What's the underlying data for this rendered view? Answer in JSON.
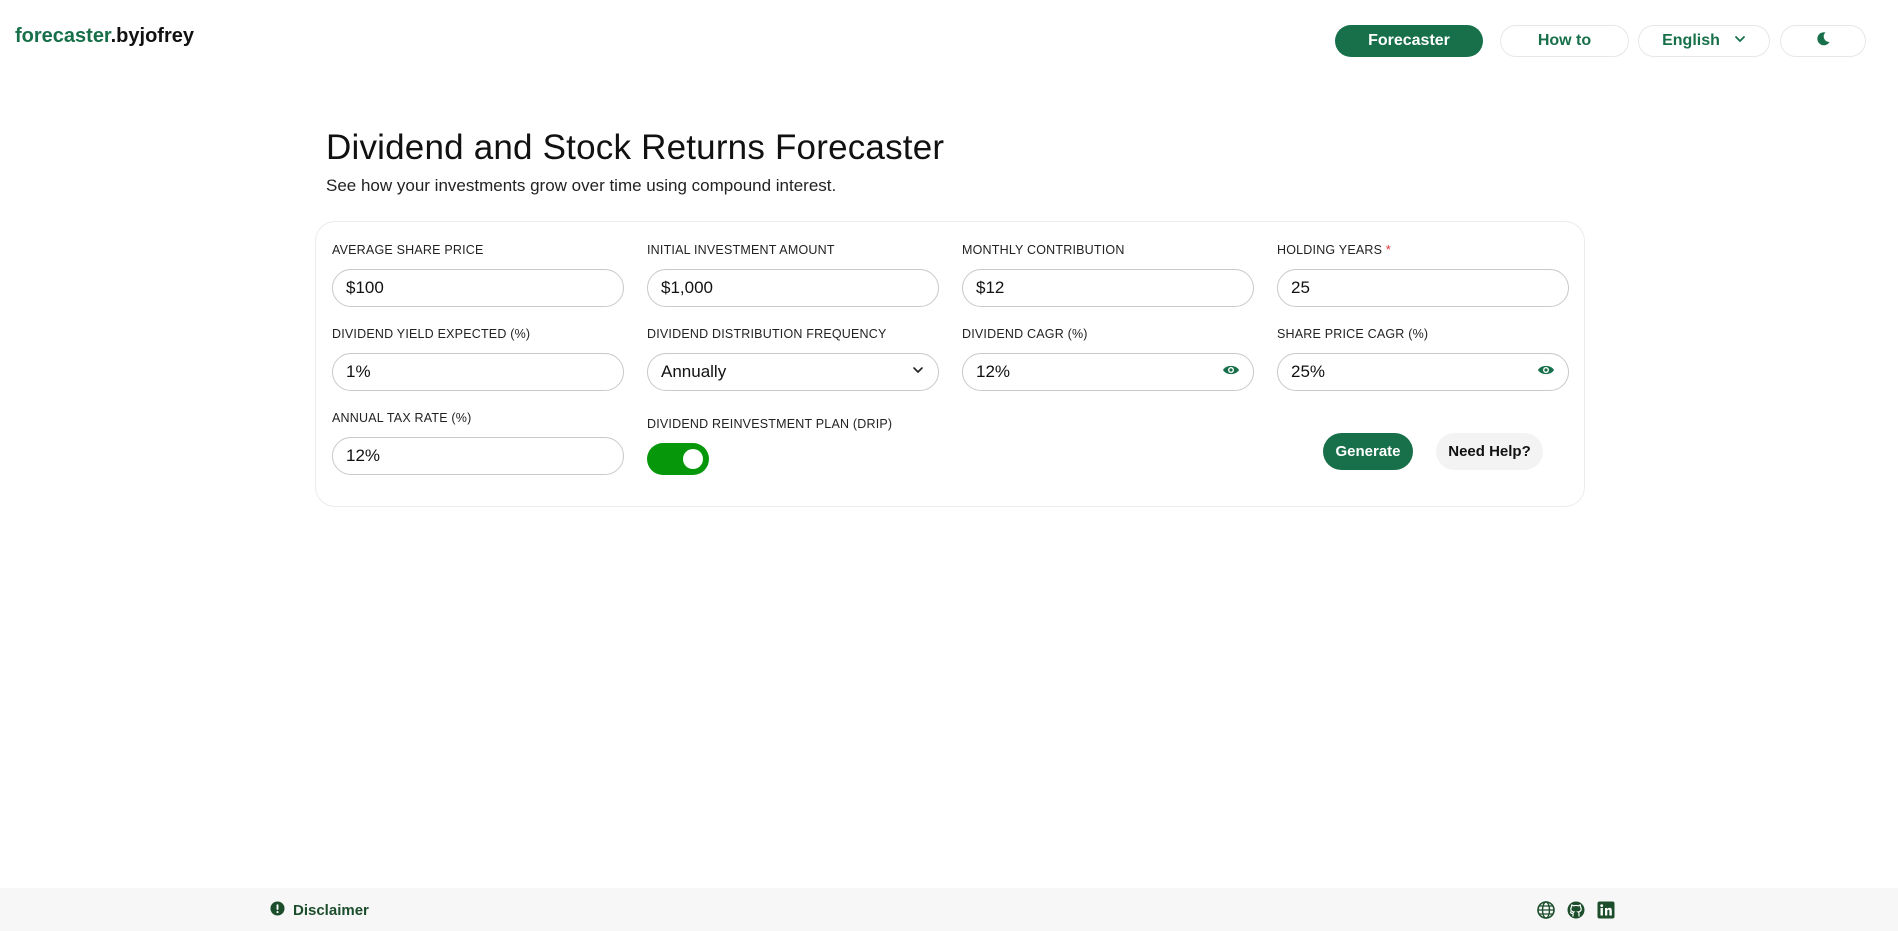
{
  "header": {
    "logo_part1": "forecaster",
    "logo_part2": ".byjofrey",
    "nav_forecaster": "Forecaster",
    "nav_howto": "How to",
    "nav_language": "English"
  },
  "page": {
    "title": "Dividend and Stock Returns Forecaster",
    "subtitle": "See how your investments grow over time using compound interest."
  },
  "form": {
    "avg_share_price": {
      "label": "AVERAGE SHARE PRICE",
      "value": "$100"
    },
    "initial_investment": {
      "label": "INITIAL INVESTMENT AMOUNT",
      "value": "$1,000"
    },
    "monthly_contribution": {
      "label": "MONTHLY CONTRIBUTION",
      "value": "$12"
    },
    "holding_years": {
      "label": "HOLDING YEARS",
      "required_mark": "*",
      "value": "25"
    },
    "dividend_yield": {
      "label": "DIVIDEND YIELD EXPECTED (%)",
      "value": "1%"
    },
    "distribution_frequency": {
      "label": "DIVIDEND DISTRIBUTION FREQUENCY",
      "value": "Annually"
    },
    "dividend_cagr": {
      "label": "DIVIDEND CAGR (%)",
      "value": "12%"
    },
    "share_price_cagr": {
      "label": "SHARE PRICE CAGR (%)",
      "value": "25%"
    },
    "tax_rate": {
      "label": "ANNUAL TAX RATE (%)",
      "value": "12%"
    },
    "drip": {
      "label": "DIVIDEND REINVESTMENT PLAN (DRIP)",
      "enabled": true
    }
  },
  "actions": {
    "generate_label": "Generate",
    "help_label": "Need Help?"
  },
  "footer": {
    "disclaimer_label": "Disclaimer"
  },
  "colors": {
    "brand": "#17704a",
    "toggle_on": "#07970b"
  }
}
